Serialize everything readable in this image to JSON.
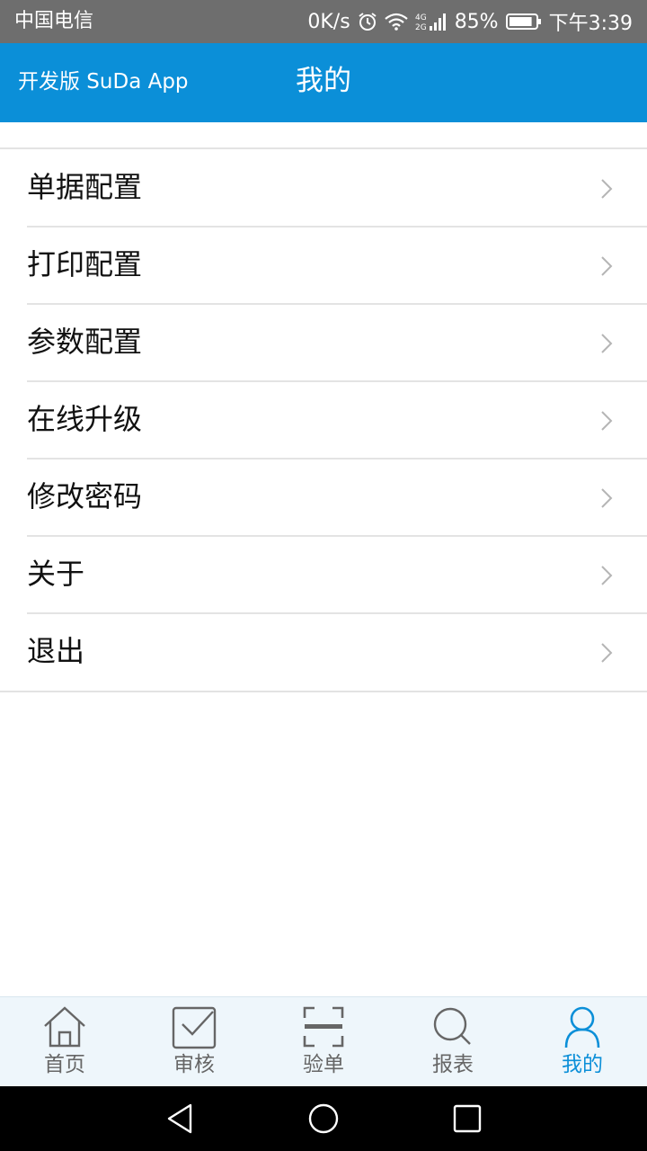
{
  "status_bar": {
    "carrier": "中国电信",
    "net_speed": "0K/s",
    "network_type": "4G/2G",
    "battery_percent": "85%",
    "time": "下午3:39",
    "battery_level": 0.85
  },
  "header": {
    "app_name": "开发版 SuDa App",
    "title": "我的",
    "background_color": "#0b8fd8"
  },
  "menu": {
    "items": [
      {
        "label": "单据配置"
      },
      {
        "label": "打印配置"
      },
      {
        "label": "参数配置"
      },
      {
        "label": "在线升级"
      },
      {
        "label": "修改密码"
      },
      {
        "label": "关于"
      },
      {
        "label": "退出"
      }
    ]
  },
  "tab_bar": {
    "tabs": [
      {
        "label": "首页",
        "icon": "home-icon"
      },
      {
        "label": "审核",
        "icon": "checkbox-icon"
      },
      {
        "label": "验单",
        "icon": "scan-icon"
      },
      {
        "label": "报表",
        "icon": "search-icon"
      },
      {
        "label": "我的",
        "icon": "user-icon",
        "active": true
      }
    ],
    "active_color": "#0b8fd8",
    "inactive_color": "#666666"
  },
  "nav_bar": {
    "buttons": [
      "back-icon",
      "home-circle-icon",
      "recents-icon"
    ]
  }
}
